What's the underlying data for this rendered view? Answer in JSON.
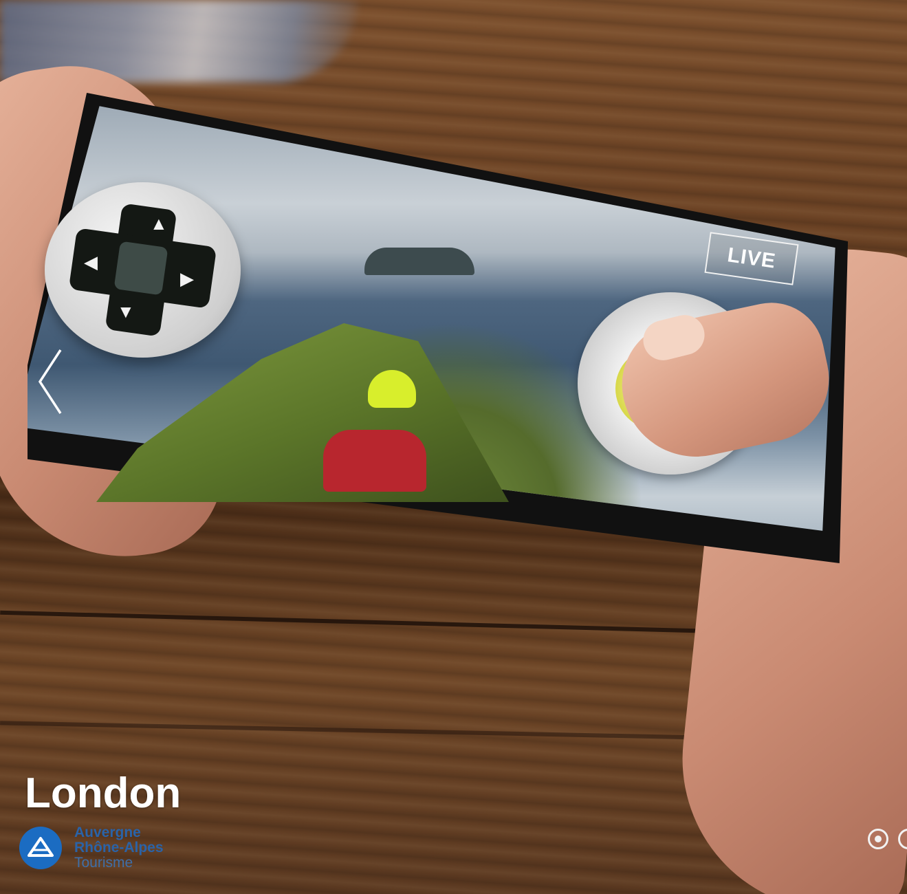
{
  "slide": {
    "title": "London",
    "screen_badge": "LIVE",
    "prev_icon": "chevron-left-icon"
  },
  "brand": {
    "line1": "Auvergne",
    "line2": "Rhône-Alpes",
    "line3": "Tourisme",
    "logo_icon": "mountain-logo-icon",
    "color": "#1b6cc2"
  },
  "pagination": {
    "total_visible": 2,
    "active_index": 0
  },
  "colors": {
    "title_text": "#ffffff",
    "badge_text": "#ffffff"
  }
}
